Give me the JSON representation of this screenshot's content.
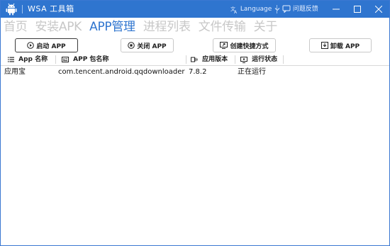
{
  "window": {
    "title": "WSA 工具箱",
    "language_label": "Language",
    "feedback_label": "问题反馈"
  },
  "nav": {
    "items": [
      {
        "label": "首页",
        "active": false
      },
      {
        "label": "安装APK",
        "active": false
      },
      {
        "label": "APP管理",
        "active": true
      },
      {
        "label": "进程列表",
        "active": false
      },
      {
        "label": "文件传输",
        "active": false
      },
      {
        "label": "关于",
        "active": false
      }
    ]
  },
  "toolbar": {
    "start_label": "启动 APP",
    "close_label": "关闭 APP",
    "shortcut_label": "创建快捷方式",
    "uninstall_label": "卸载 APP"
  },
  "table": {
    "columns": [
      "App 名称",
      "APP 包名称",
      "应用版本",
      "运行状态"
    ],
    "rows": [
      {
        "name": "应用宝",
        "package": "com.tencent.android.qqdownloader",
        "version": "7.8.2",
        "status": "正在运行"
      }
    ]
  },
  "colors": {
    "titlebar": "#2f75cf",
    "nav_active": "#2f75cf",
    "nav_inactive": "#c7c7c7"
  }
}
